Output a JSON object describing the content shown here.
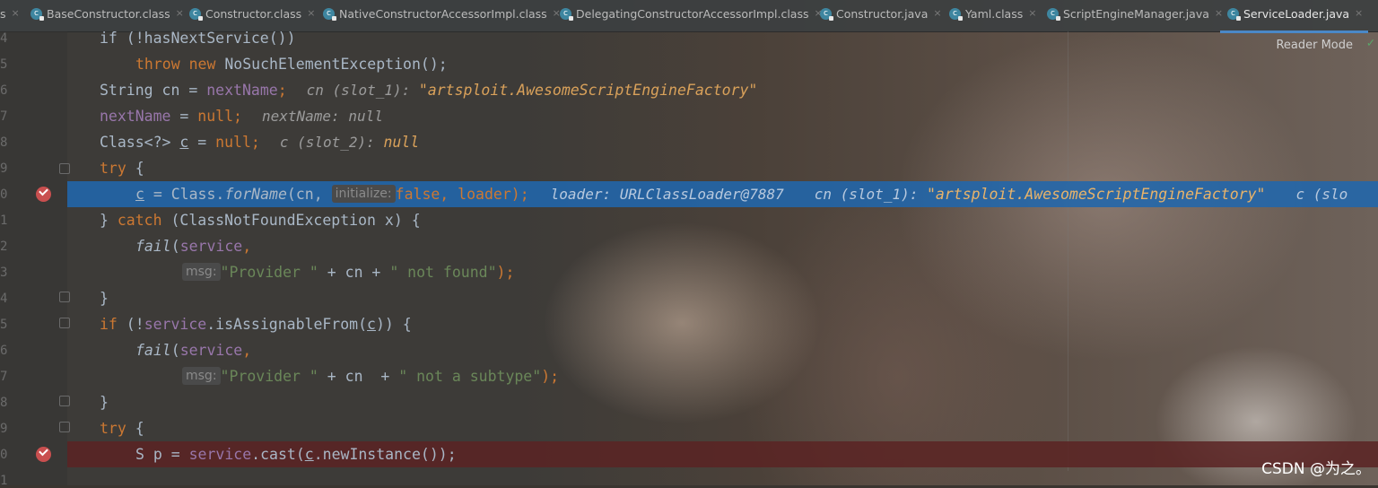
{
  "tabs": [
    {
      "label": "s",
      "icon": "class-icon",
      "active": false
    },
    {
      "label": "BaseConstructor.class",
      "icon": "class-icon",
      "active": false
    },
    {
      "label": "Constructor.class",
      "icon": "class-icon",
      "active": false
    },
    {
      "label": "NativeConstructorAccessorImpl.class",
      "icon": "class-icon",
      "active": false
    },
    {
      "label": "DelegatingConstructorAccessorImpl.class",
      "icon": "class-icon",
      "active": false
    },
    {
      "label": "Constructor.java",
      "icon": "class-icon",
      "active": false
    },
    {
      "label": "Yaml.class",
      "icon": "class-icon",
      "active": false
    },
    {
      "label": "ScriptEngineManager.java",
      "icon": "class-icon",
      "active": false
    },
    {
      "label": "ServiceLoader.java",
      "icon": "class-icon",
      "active": true
    }
  ],
  "reader_mode": "Reader Mode",
  "line_numbers": [
    "4",
    "5",
    "6",
    "7",
    "8",
    "9",
    "0",
    "1",
    "2",
    "3",
    "4",
    "5",
    "6",
    "7",
    "8",
    "9",
    "0",
    "1"
  ],
  "code": {
    "l1": "if (!hasNextService())",
    "l2_kw": "throw new",
    "l2_rest": " NoSuchElementException();",
    "l3_a": "String cn = ",
    "l3_field": "nextName",
    "l3_semi": ";",
    "l3_hint": "cn (slot_1): ",
    "l3_hintv": "\"artsploit.AwesomeScriptEngineFactory\"",
    "l4_field": "nextName",
    "l4_a": " = ",
    "l4_kw": "null",
    "l4_semi": ";",
    "l4_hint": "nextName: null",
    "l5_a": "Class<?> ",
    "l5_c": "c",
    "l5_b": " = ",
    "l5_kw": "null",
    "l5_semi": ";",
    "l5_hint": "c (slot_2): ",
    "l5_hintv": "null",
    "l6_kw": "try",
    "l6_rest": " {",
    "l7_c": "c",
    "l7_a": " = Class.",
    "l7_fn": "forName",
    "l7_b": "(cn, ",
    "l7_param": "initialize:",
    "l7_kw": "false, loader",
    "l7_end": ");",
    "l7_dbg1": "loader: URLClassLoader@7887",
    "l7_dbg2": "cn (slot_1): ",
    "l7_dbg2v": "\"artsploit.AwesomeScriptEngineFactory\"",
    "l7_dbg3": "c (slo",
    "l8_a": "} ",
    "l8_kw": "catch",
    "l8_rest": " (ClassNotFoundException x) {",
    "l9_fn": "fail",
    "l9_a": "(",
    "l9_field": "service",
    "l9_b": ",",
    "l10_param": "msg:",
    "l10_str1": "\"Provider \"",
    "l10_a": " + cn + ",
    "l10_str2": "\" not found\"",
    "l10_end": ");",
    "l11": "}",
    "l12_kw": "if",
    "l12_a": " (!",
    "l12_field": "service",
    "l12_b": ".isAssignableFrom(",
    "l12_c": "c",
    "l12_end": ")) {",
    "l13_fn": "fail",
    "l13_a": "(",
    "l13_field": "service",
    "l13_b": ",",
    "l14_param": "msg:",
    "l14_str1": "\"Provider \"",
    "l14_a": " + cn  + ",
    "l14_str2": "\" not a subtype\"",
    "l14_end": ");",
    "l15": "}",
    "l16_kw": "try",
    "l16_rest": " {",
    "l17_a": "S p = ",
    "l17_field": "service",
    "l17_b": ".cast(",
    "l17_c": "c",
    "l17_end": ".newInstance());"
  },
  "watermark": "CSDN @为之。",
  "colors": {
    "keyword": "#cc7832",
    "field": "#9876aa",
    "string": "#6a8759",
    "highlight": "#2166ac",
    "breakpoint": "#c94f4f"
  }
}
